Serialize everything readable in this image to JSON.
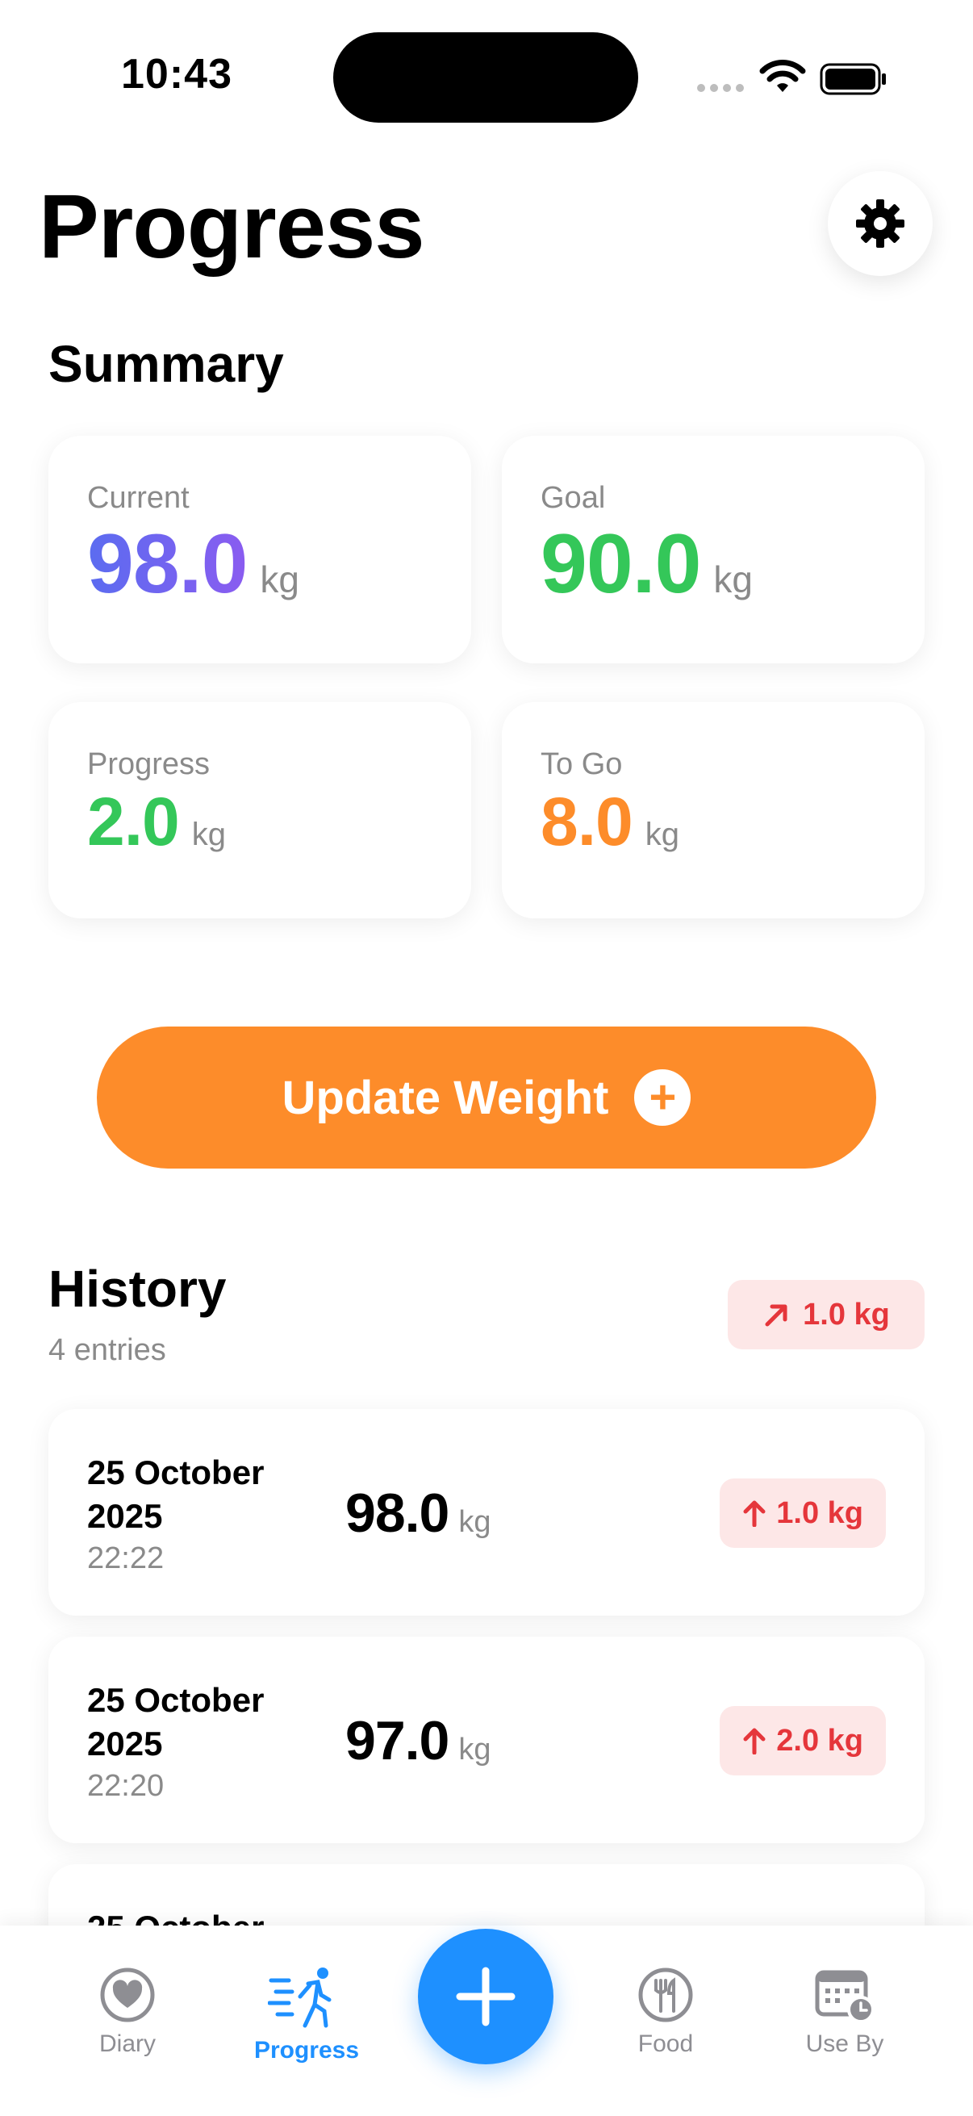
{
  "status_bar": {
    "time": "10:43"
  },
  "header": {
    "title": "Progress"
  },
  "summary": {
    "title": "Summary",
    "current": {
      "label": "Current",
      "value": "98.0",
      "unit": "kg"
    },
    "goal": {
      "label": "Goal",
      "value": "90.0",
      "unit": "kg"
    },
    "progress": {
      "label": "Progress",
      "value": "2.0",
      "unit": "kg"
    },
    "to_go": {
      "label": "To Go",
      "value": "8.0",
      "unit": "kg"
    }
  },
  "update_button": {
    "label": "Update Weight"
  },
  "history": {
    "title": "History",
    "count": "4 entries",
    "trend": "1.0 kg",
    "entries": [
      {
        "date": "25 October 2025",
        "time": "22:22",
        "weight": "98.0",
        "unit": "kg",
        "change": "1.0 kg"
      },
      {
        "date": "25 October 2025",
        "time": "22:20",
        "weight": "97.0",
        "unit": "kg",
        "change": "2.0 kg"
      },
      {
        "date": "25 October",
        "time": "",
        "weight": "",
        "unit": "",
        "change": ""
      }
    ]
  },
  "tabbar": {
    "tabs": [
      {
        "label": "Diary",
        "icon": "heart-icon"
      },
      {
        "label": "Progress",
        "icon": "walking-person-icon",
        "active": true
      },
      {
        "label": "Food",
        "icon": "fork-knife-icon"
      },
      {
        "label": "Use By",
        "icon": "calendar-clock-icon"
      }
    ]
  },
  "colors": {
    "accent_orange": "#fd8c2a",
    "accent_blue": "#1e90ff",
    "green": "#34c759",
    "red": "#e5363b",
    "purple_start": "#5b6cf0",
    "purple_end": "#8a5cf0"
  }
}
